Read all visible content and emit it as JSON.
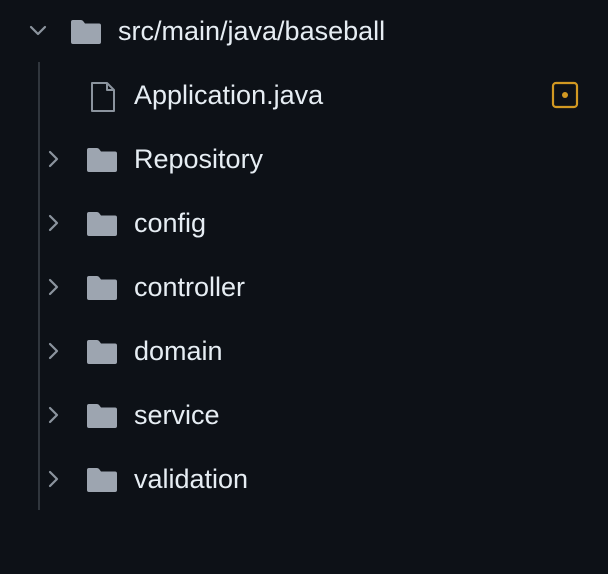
{
  "root": {
    "label": "src/main/java/baseball",
    "expanded": true
  },
  "file": {
    "label": "Application.java",
    "status_badge": "modified-dot-icon"
  },
  "folders": [
    {
      "label": "Repository"
    },
    {
      "label": "config"
    },
    {
      "label": "controller"
    },
    {
      "label": "domain"
    },
    {
      "label": "service"
    },
    {
      "label": "validation"
    }
  ],
  "colors": {
    "background": "#0d1117",
    "text": "#e6edf3",
    "icon": "#8b949e",
    "folder": "#9da5b0",
    "guide": "#30363d",
    "badge": "#d29922"
  }
}
